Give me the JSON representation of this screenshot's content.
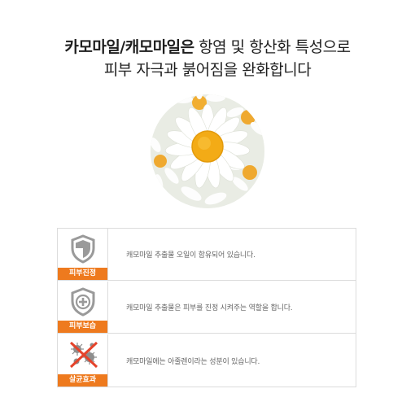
{
  "headline": {
    "line1_bold": "카모마일/캐모마일은",
    "line1_rest": " 항염 및 항산화 특성으로",
    "line2": "피부 자극과 붉어짐을 완화합니다"
  },
  "image": {
    "subject": "chamomile-flower-photo"
  },
  "benefits": [
    {
      "tag": "피부진정",
      "icon": "shield-icon",
      "description": "캐모마일 추출물 오일이 함유되어 있습니다."
    },
    {
      "tag": "피부보습",
      "icon": "shield-plus-icon",
      "description": "캐모마일 추출물은 피부를 진정 시켜주는 역할을 합니다."
    },
    {
      "tag": "살균효과",
      "icon": "germ-cross-icon",
      "description": "캐모마일에는 아줄렌이라는 성분이 있습니다."
    }
  ],
  "colors": {
    "accent": "#ee7a1e",
    "border": "#dcdcdc",
    "icon_gray": "#9a9a9a"
  }
}
